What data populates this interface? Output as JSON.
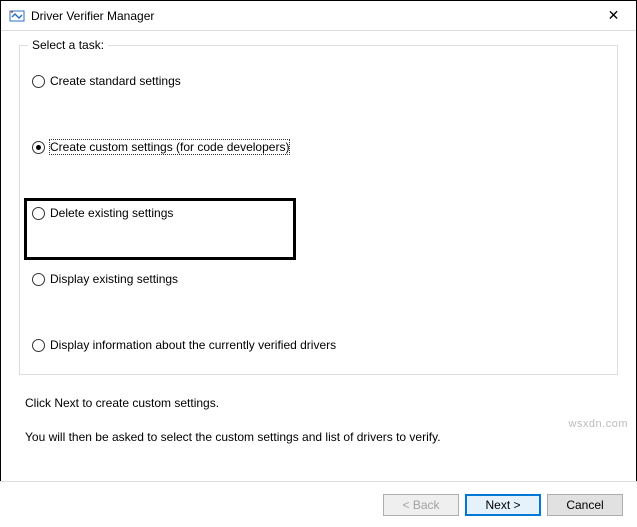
{
  "window": {
    "title": "Driver Verifier Manager",
    "close_glyph": "✕"
  },
  "group": {
    "label": "Select a task:"
  },
  "options": {
    "standard": "Create standard settings",
    "custom": "Create custom settings (for code developers)",
    "delete": "Delete existing settings",
    "display": "Display existing settings",
    "info": "Display information about the currently verified drivers",
    "selected_index": 1
  },
  "instructions": {
    "line1": "Click Next to create custom settings.",
    "line2": "You will then be asked to select the custom settings and list of drivers to verify."
  },
  "buttons": {
    "back": "< Back",
    "next": "Next >",
    "cancel": "Cancel"
  },
  "watermark": "wsxdn.com"
}
